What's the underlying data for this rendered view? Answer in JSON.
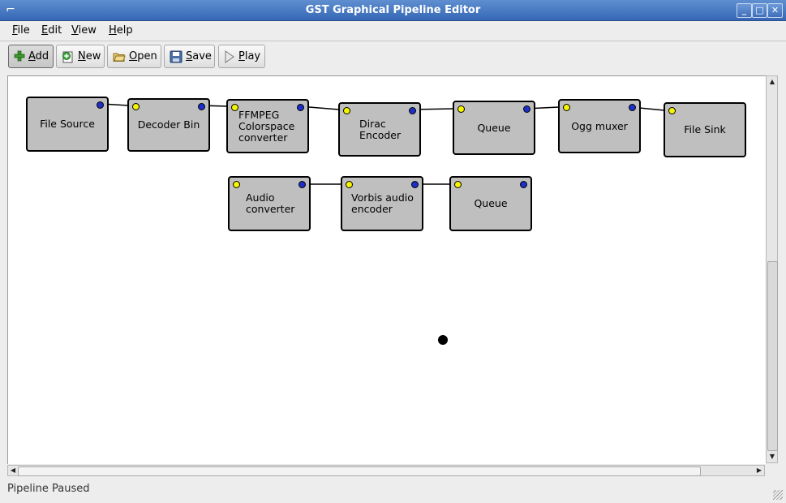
{
  "window": {
    "title": "GST Graphical Pipeline Editor",
    "controls": {
      "minimize": "minimize-icon",
      "maximize": "maximize-icon",
      "close": "close-icon"
    }
  },
  "menubar": {
    "items": [
      {
        "label": "File",
        "mnemonic": "F",
        "rest": "ile"
      },
      {
        "label": "Edit",
        "mnemonic": "E",
        "rest": "dit"
      },
      {
        "label": "View",
        "mnemonic": "V",
        "rest": "iew"
      },
      {
        "label": "Help",
        "mnemonic": "H",
        "rest": "elp"
      }
    ]
  },
  "toolbar": {
    "buttons": [
      {
        "label": "Add",
        "mnemonic": "A",
        "rest": "dd",
        "icon": "add-icon"
      },
      {
        "label": "New",
        "mnemonic": "N",
        "rest": "ew",
        "icon": "new-icon"
      },
      {
        "label": "Open",
        "mnemonic": "O",
        "rest": "pen",
        "icon": "open-folder-icon"
      },
      {
        "label": "Save",
        "mnemonic": "S",
        "rest": "ave",
        "icon": "save-icon"
      },
      {
        "label": "Play",
        "mnemonic": "P",
        "rest": "lay",
        "icon": "play-icon"
      }
    ]
  },
  "pipeline": {
    "elements": [
      {
        "label": "File Source"
      },
      {
        "label": "Decoder Bin"
      },
      {
        "label": "FFMPEG Colorspace converter"
      },
      {
        "label": "Dirac Encoder"
      },
      {
        "label": "Queue"
      },
      {
        "label": "Ogg muxer"
      },
      {
        "label": "File Sink"
      },
      {
        "label": "Audio converter"
      },
      {
        "label": "Vorbis audio encoder"
      },
      {
        "label": "Queue"
      }
    ]
  },
  "status": {
    "text": "Pipeline Paused"
  },
  "colors": {
    "titlebar": "#3567b5",
    "node": "#bfbfbf",
    "sink_pad": "#f5f500",
    "src_pad": "#1d2fc8"
  }
}
